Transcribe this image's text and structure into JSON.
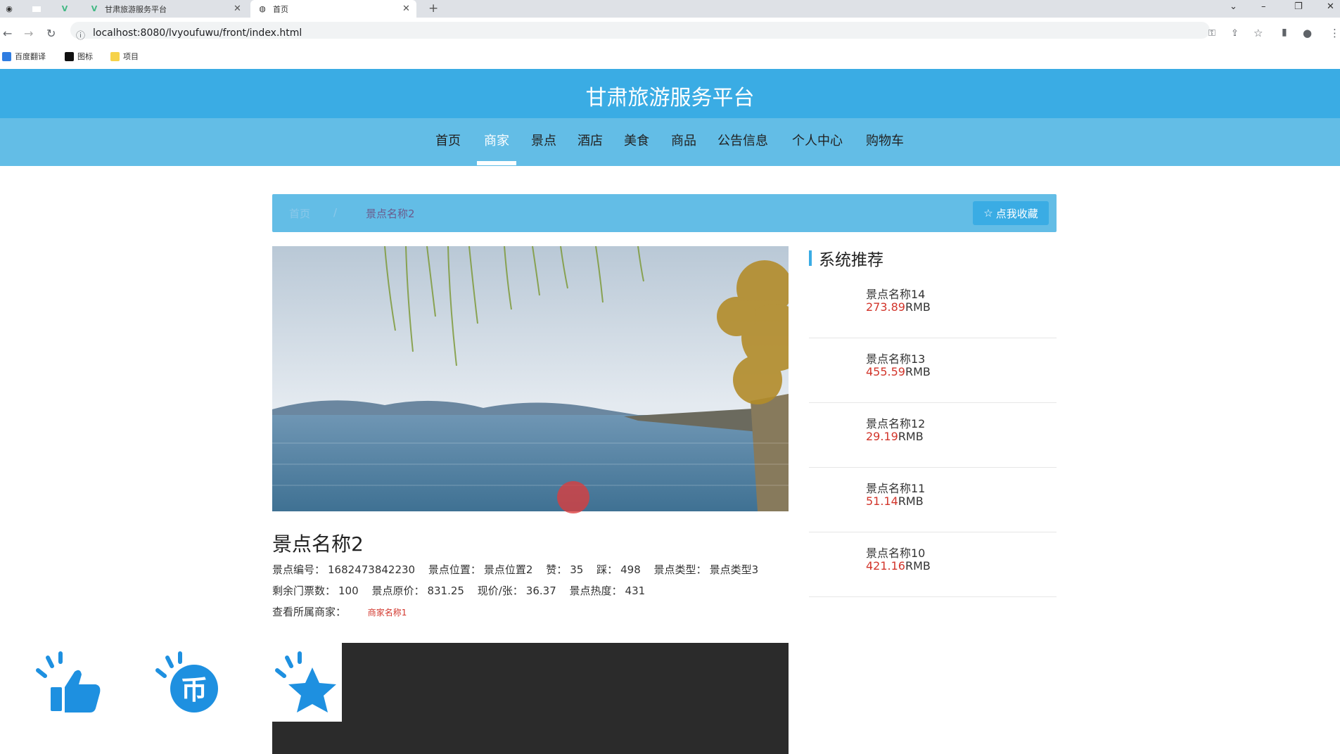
{
  "browser": {
    "tabs": [
      {
        "title": "甘肃旅游服务平台"
      },
      {
        "title": "首页"
      }
    ],
    "url": "localhost:8080/lvyoufuwu/front/index.html",
    "bookmarks": [
      "百度翻译",
      "图标",
      "项目"
    ]
  },
  "site": {
    "title": "甘肃旅游服务平台",
    "menu": [
      "首页",
      "商家",
      "景点",
      "酒店",
      "美食",
      "商品",
      "公告信息",
      "个人中心",
      "购物车"
    ],
    "active_menu": "商家"
  },
  "breadcrumb": {
    "home": "首页",
    "sep": "/",
    "current": "景点名称2",
    "favorite_button": "点我收藏"
  },
  "detail": {
    "title": "景点名称2",
    "row1": [
      {
        "label": "景点编号：",
        "value": "1682473842230"
      },
      {
        "label": "景点位置：",
        "value": "景点位置2"
      },
      {
        "label": "赞：",
        "value": "35"
      },
      {
        "label": "踩：",
        "value": "498"
      },
      {
        "label": "景点类型：",
        "value": "景点类型3"
      }
    ],
    "row2": [
      {
        "label": "剩余门票数：",
        "value": "100"
      },
      {
        "label": "景点原价：",
        "value": "831.25"
      },
      {
        "label": "现价/张：",
        "value": "36.37"
      },
      {
        "label": "景点热度：",
        "value": "431"
      }
    ],
    "merchant_label": "查看所属商家：",
    "merchant_value": "商家名称1"
  },
  "recommend": {
    "title": "系统推荐",
    "items": [
      {
        "name": "景点名称14",
        "price": "273.89",
        "unit": "RMB"
      },
      {
        "name": "景点名称13",
        "price": "455.59",
        "unit": "RMB"
      },
      {
        "name": "景点名称12",
        "price": "29.19",
        "unit": "RMB"
      },
      {
        "name": "景点名称11",
        "price": "51.14",
        "unit": "RMB"
      },
      {
        "name": "景点名称10",
        "price": "421.16",
        "unit": "RMB"
      }
    ]
  },
  "actions": {
    "icons": [
      "thumbs-up-icon",
      "coin-icon",
      "star-icon"
    ],
    "coin_glyph": "币"
  },
  "colors": {
    "header": "#3aace4",
    "menu": "#63bde6",
    "price": "#d2352b",
    "action": "#1e90e0"
  }
}
